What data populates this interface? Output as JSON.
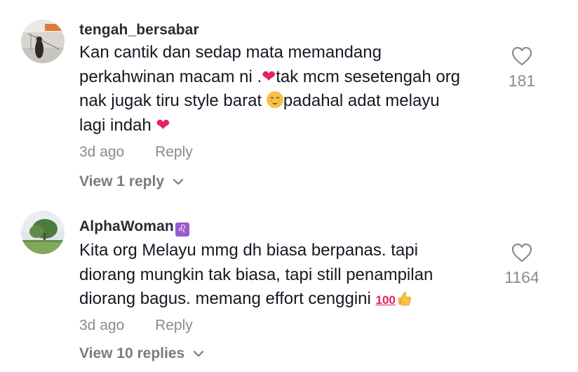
{
  "comments": [
    {
      "username": "tengah_bersabar",
      "text_line1": "Kan cantik dan sedap mata memandang",
      "text_line2a": "perkahwinan macam ni .",
      "text_line2b": "tak mcm sesetengah org",
      "text_line3a": "nak jugak tiru style barat ",
      "text_line3b": "padahal adat melayu",
      "text_line4": "lagi indah ",
      "age": "3d ago",
      "reply_label": "Reply",
      "view_replies": "View 1 reply",
      "like_count": "181"
    },
    {
      "username": "AlphaWoman",
      "username_emoji": "♌",
      "text_line1": "Kita org Melayu mmg dh biasa berpanas. tapi",
      "text_line2": "diorang mungkin tak biasa, tapi still penampilan",
      "text_line3": "diorang bagus. memang effort cenggini ",
      "age": "3d ago",
      "reply_label": "Reply",
      "view_replies": "View 10 replies",
      "like_count": "1164"
    }
  ],
  "icons": {
    "heart_outline": "heart-icon",
    "chevron": "chevron-down-icon",
    "red_heart_emoji": "❤",
    "hundred_emoji": "100"
  },
  "colors": {
    "text": "#161823",
    "muted": "#8a8b91",
    "heart_emoji": "#e0245e"
  }
}
